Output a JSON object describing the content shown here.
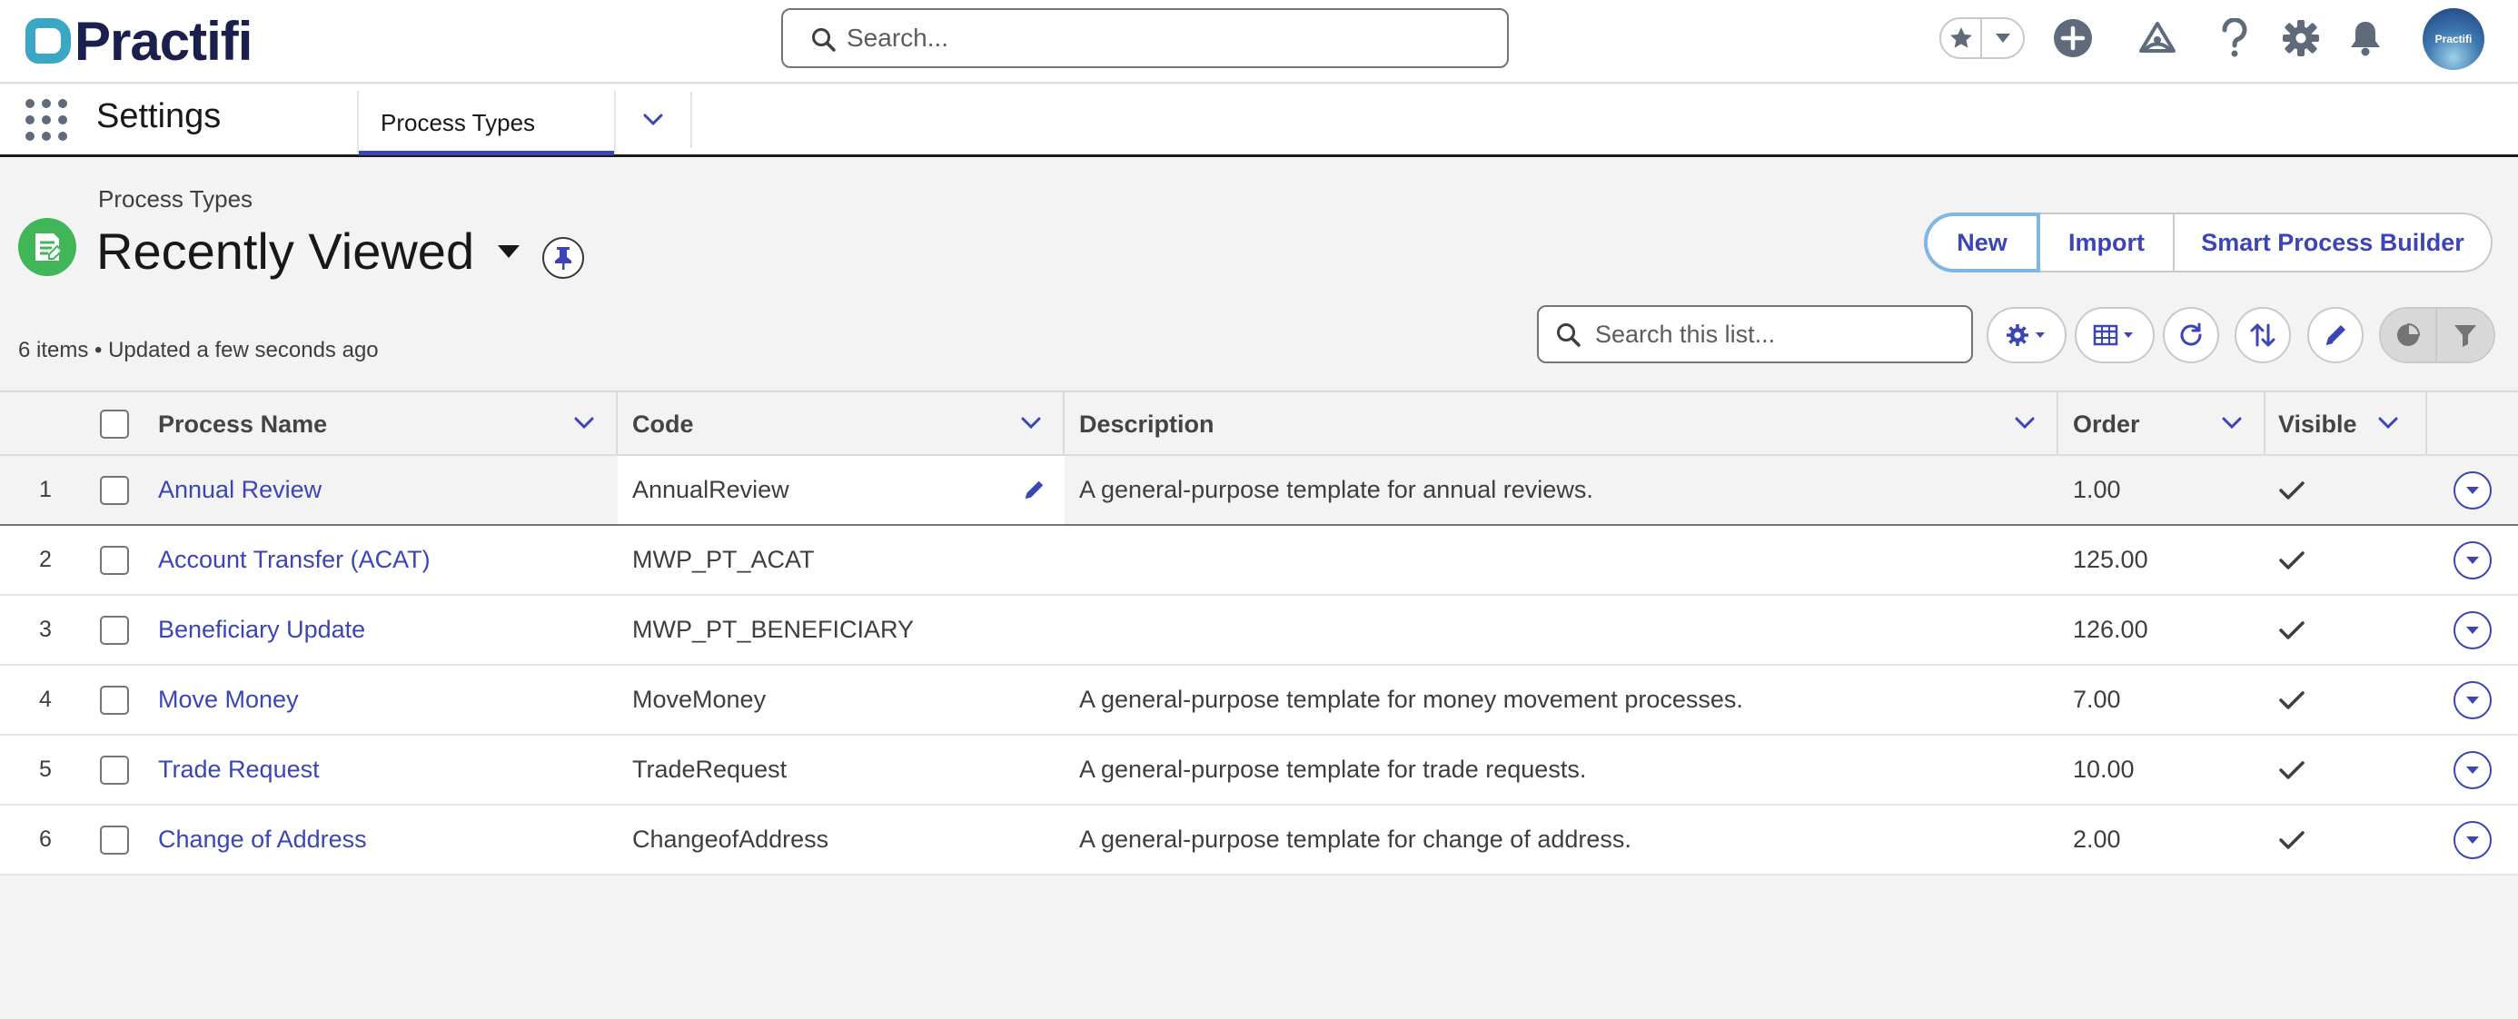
{
  "header": {
    "logo_text": "Practifi",
    "search_placeholder": "Search...",
    "avatar_text": "Practifi"
  },
  "nav": {
    "app_name": "Settings",
    "tabs": [
      {
        "label": "Process Types"
      }
    ]
  },
  "list": {
    "breadcrumb": "Process Types",
    "title": "Recently Viewed",
    "meta": "6 items • Updated a few seconds ago",
    "search_placeholder": "Search this list..."
  },
  "actions": {
    "new": "New",
    "import": "Import",
    "smart_builder": "Smart Process Builder"
  },
  "table": {
    "columns": [
      "Process Name",
      "Code",
      "Description",
      "Order",
      "Visible"
    ],
    "rows": [
      {
        "num": "1",
        "name": "Annual Review",
        "code": "AnnualReview",
        "description": "A general-purpose template for annual reviews.",
        "order": "1.00",
        "visible": true
      },
      {
        "num": "2",
        "name": "Account Transfer (ACAT)",
        "code": "MWP_PT_ACAT",
        "description": "",
        "order": "125.00",
        "visible": true
      },
      {
        "num": "3",
        "name": "Beneficiary Update",
        "code": "MWP_PT_BENEFICIARY",
        "description": "",
        "order": "126.00",
        "visible": true
      },
      {
        "num": "4",
        "name": "Move Money",
        "code": "MoveMoney",
        "description": "A general-purpose template for money movement processes.",
        "order": "7.00",
        "visible": true
      },
      {
        "num": "5",
        "name": "Trade Request",
        "code": "TradeRequest",
        "description": "A general-purpose template for trade requests.",
        "order": "10.00",
        "visible": true
      },
      {
        "num": "6",
        "name": "Change of Address",
        "code": "ChangeofAddress",
        "description": "A general-purpose template for change of address.",
        "order": "2.00",
        "visible": true
      }
    ]
  },
  "colors": {
    "brand": "#1b1f4b",
    "accent": "#3b45b5",
    "logo_teal": "#3ba7c4",
    "object_icon": "#41b658"
  }
}
